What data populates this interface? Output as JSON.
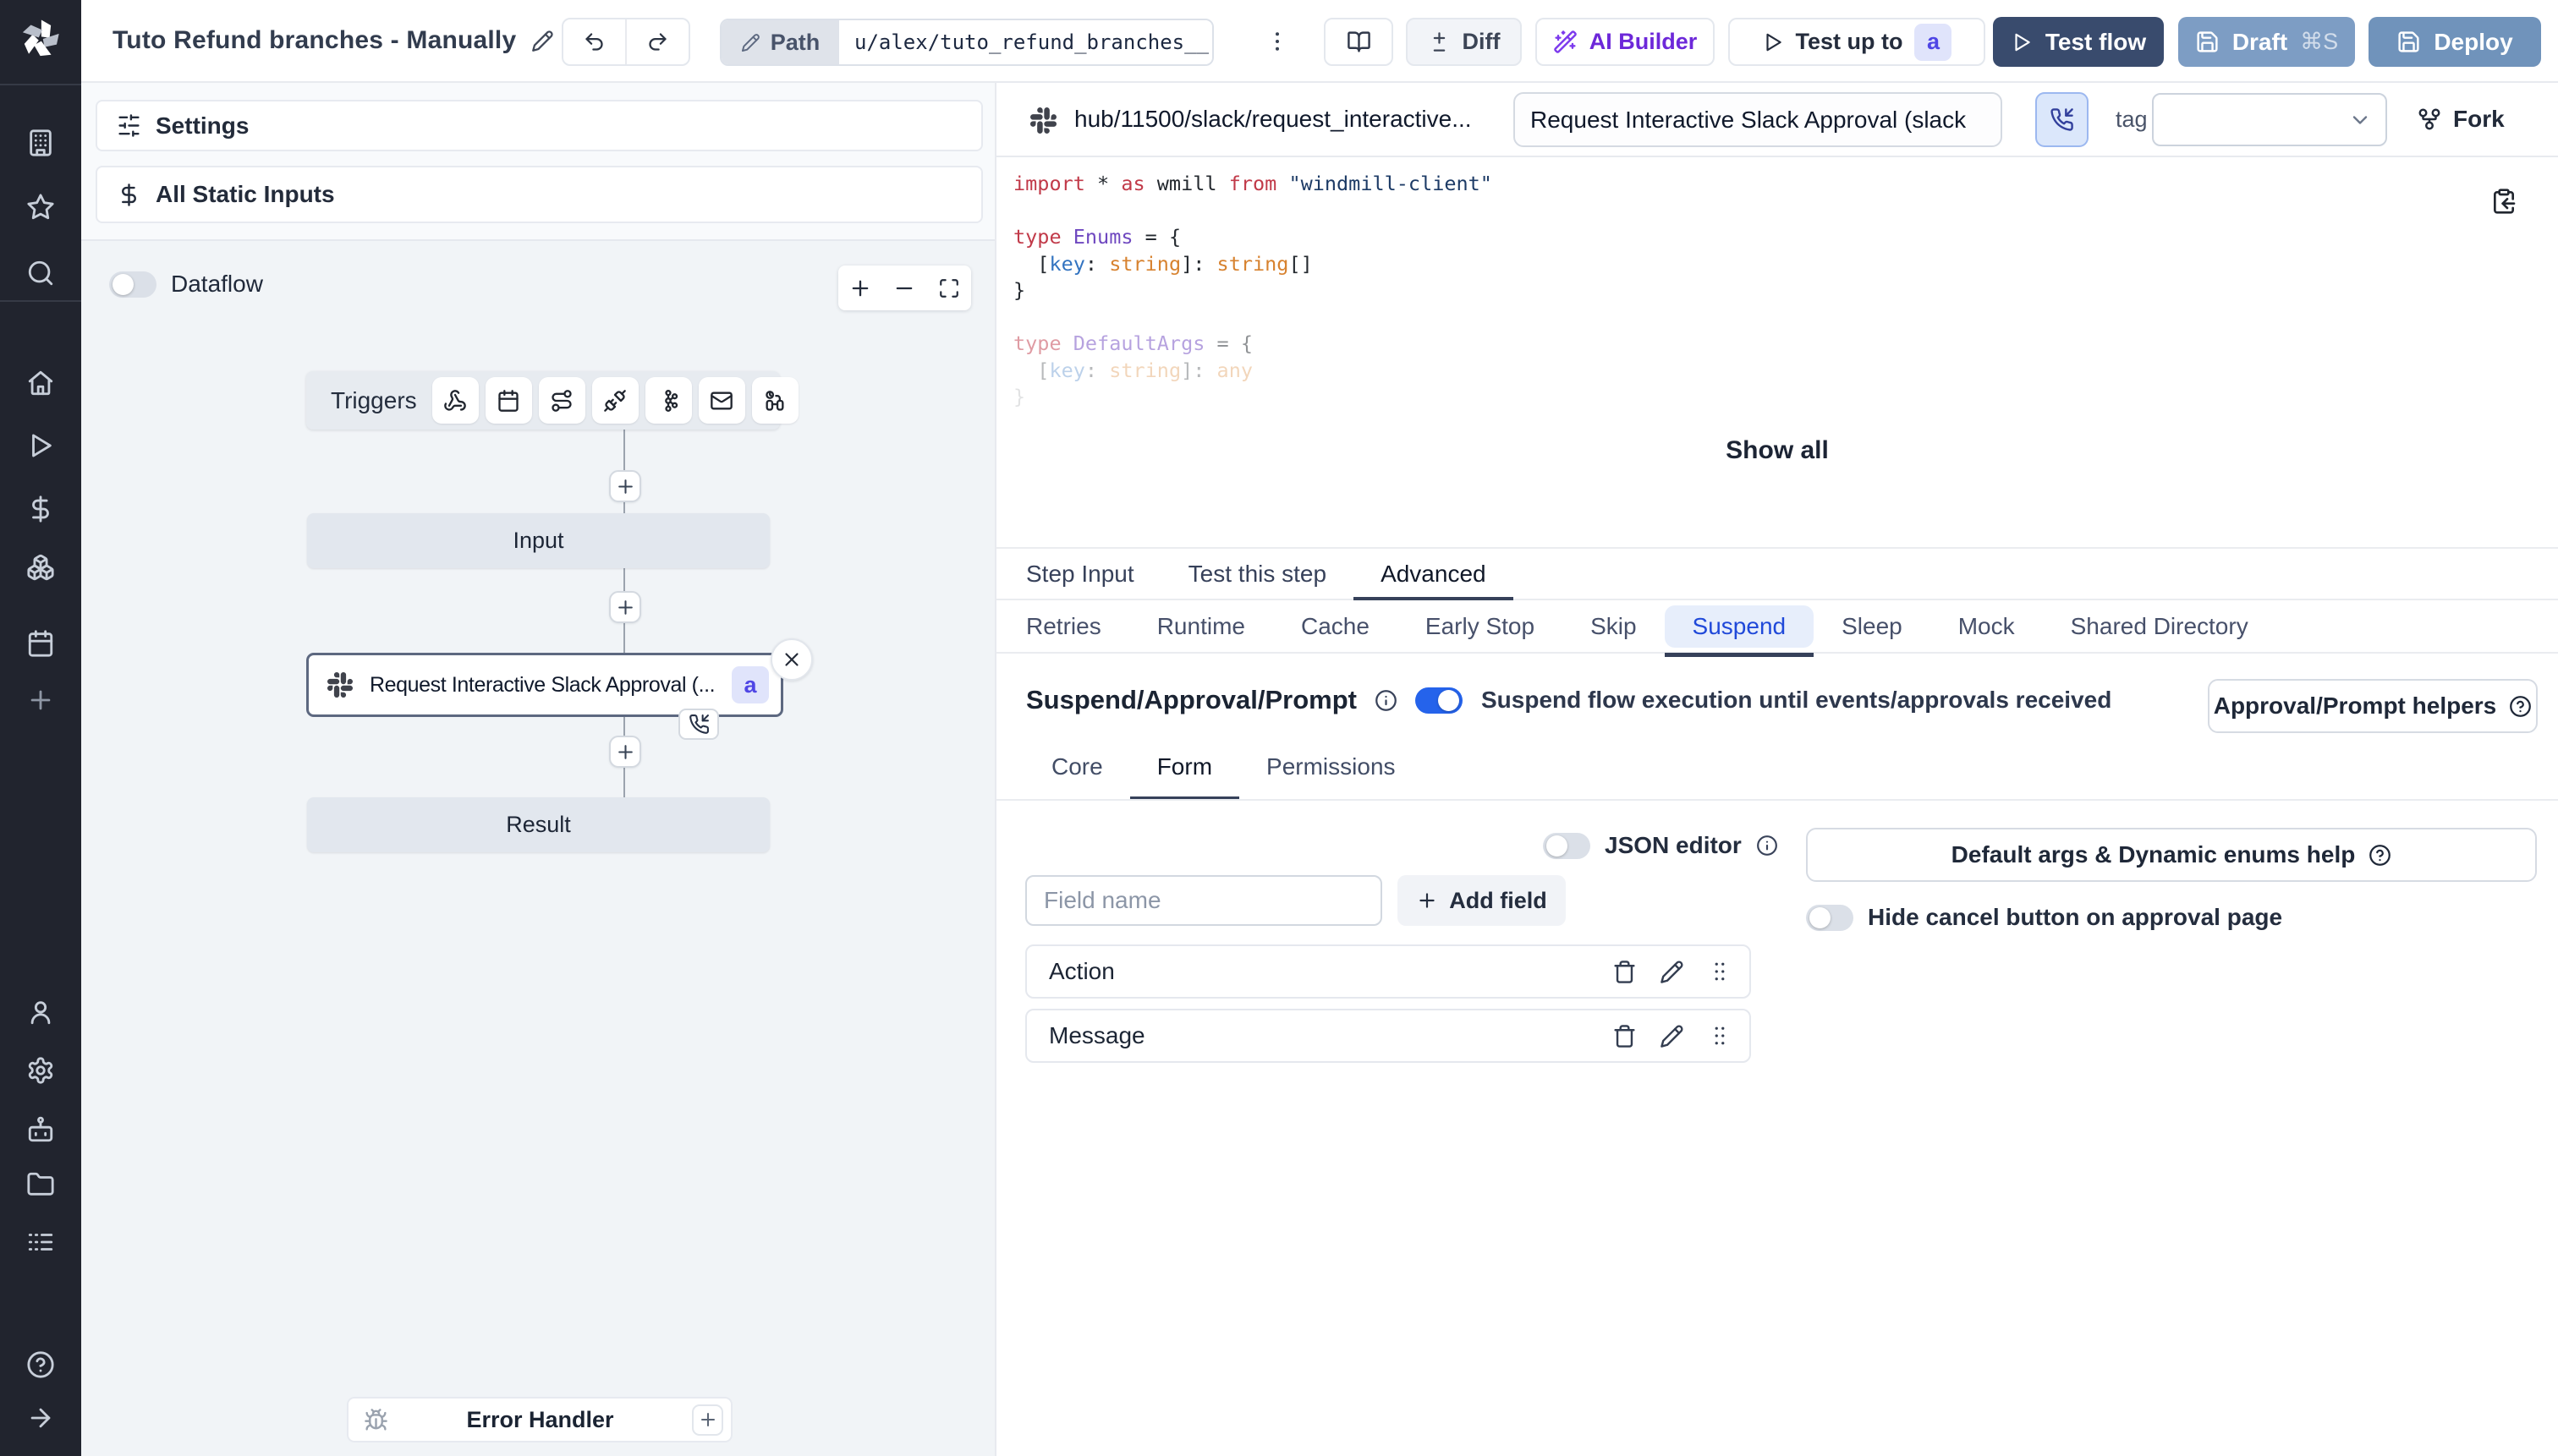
{
  "accent_colors": {
    "toggle_on": "#2563eb",
    "test_flow_bg": "#394b6d",
    "draft_bg": "#7d9dc4",
    "deploy_bg": "#7093bb",
    "ai_builder_text": "#6d28d9",
    "suspend_tab_text": "#2049d9",
    "suspend_tab_bg": "#e7eefb",
    "badge_bg": "#e0e4fb",
    "badge_text": "#4f46e5",
    "sidebar_bg": "#21242e"
  },
  "sidebar": {
    "logo_icon": "windmill-logo",
    "items": [
      {
        "name": "workspace",
        "icon": "building-icon",
        "group": 1
      },
      {
        "name": "favorites",
        "icon": "star-icon",
        "group": 1
      },
      {
        "name": "search",
        "icon": "search-icon",
        "group": 1
      },
      {
        "name": "home",
        "icon": "home-icon",
        "group": 2
      },
      {
        "name": "runs",
        "icon": "play-icon",
        "group": 2
      },
      {
        "name": "variables",
        "icon": "dollar-icon",
        "group": 2
      },
      {
        "name": "resources",
        "icon": "boxes-icon",
        "group": 2
      },
      {
        "name": "schedules",
        "icon": "calendar-icon",
        "group": 2
      },
      {
        "name": "more",
        "icon": "plus-icon",
        "group": 2
      },
      {
        "name": "account",
        "icon": "user-icon",
        "group": 3
      },
      {
        "name": "settings",
        "icon": "gear-icon",
        "group": 3
      },
      {
        "name": "workers",
        "icon": "robot-icon",
        "group": 3
      },
      {
        "name": "folders",
        "icon": "folder-icon",
        "group": 3
      },
      {
        "name": "audit-logs",
        "icon": "logs-icon",
        "group": 3
      },
      {
        "name": "help",
        "icon": "help-icon",
        "group": 4
      },
      {
        "name": "expand",
        "icon": "arrow-right-icon",
        "group": 4
      }
    ]
  },
  "header": {
    "title": "Tuto Refund branches - Manually",
    "path_label": "Path",
    "path_value": "u/alex/tuto_refund_branches__",
    "diff_label": "Diff",
    "ai_builder_label": "AI Builder",
    "test_up_to_label": "Test up to",
    "test_up_to_badge": "a",
    "test_flow_label": "Test flow",
    "draft_label": "Draft",
    "draft_shortcut": "⌘S",
    "deploy_label": "Deploy"
  },
  "left_panel": {
    "settings_label": "Settings",
    "static_inputs_label": "All Static Inputs",
    "dataflow_label": "Dataflow",
    "dataflow_on": false,
    "graph": {
      "triggers_label": "Triggers",
      "trigger_icons": [
        "webhook-icon",
        "calendar-icon",
        "route-icon",
        "plug-icon",
        "kafka-icon",
        "mail-icon",
        "poll-icon"
      ],
      "input_label": "Input",
      "step": {
        "name": "Request Interactive Slack Approval (...",
        "badge": "a",
        "icon": "slack-icon"
      },
      "result_label": "Result",
      "error_handler_label": "Error Handler"
    }
  },
  "right_panel": {
    "script_path": "hub/11500/slack/request_interactive...",
    "step_name_value": "Request Interactive Slack Approval (slack",
    "tag_label": "tag",
    "tag_value": "",
    "fork_label": "Fork",
    "code": {
      "show_all_label": "Show all",
      "lines": [
        {
          "opacity": 1,
          "tokens": [
            [
              "import",
              "kw"
            ],
            [
              " * ",
              "pl"
            ],
            [
              "as",
              "kw"
            ],
            [
              " wmill ",
              "pl"
            ],
            [
              "from",
              "kw"
            ],
            [
              " ",
              "pl"
            ],
            [
              "\"windmill-client\"",
              "str"
            ]
          ]
        },
        {
          "opacity": 1,
          "tokens": []
        },
        {
          "opacity": 1,
          "tokens": [
            [
              "type",
              "kw"
            ],
            [
              " ",
              "pl"
            ],
            [
              "Enums",
              "tp"
            ],
            [
              " = {",
              "pl"
            ]
          ]
        },
        {
          "opacity": 1,
          "tokens": [
            [
              "  [",
              "pl"
            ],
            [
              "key",
              "id"
            ],
            [
              ": ",
              "pl"
            ],
            [
              "string",
              "ty"
            ],
            [
              "]: ",
              "pl"
            ],
            [
              "string",
              "ty"
            ],
            [
              "[]",
              "pl"
            ]
          ]
        },
        {
          "opacity": 1,
          "tokens": [
            [
              "}",
              "pl"
            ]
          ]
        },
        {
          "opacity": 1,
          "tokens": []
        },
        {
          "opacity": 0.5,
          "tokens": [
            [
              "type",
              "kw"
            ],
            [
              " ",
              "pl"
            ],
            [
              "DefaultArgs",
              "tp"
            ],
            [
              " = {",
              "pl"
            ]
          ]
        },
        {
          "opacity": 0.32,
          "tokens": [
            [
              "  [",
              "pl"
            ],
            [
              "key",
              "id"
            ],
            [
              ": ",
              "pl"
            ],
            [
              "string",
              "ty"
            ],
            [
              "]: ",
              "pl"
            ],
            [
              "any",
              "ty"
            ]
          ]
        },
        {
          "opacity": 0.13,
          "tokens": [
            [
              "}",
              "pl"
            ]
          ]
        }
      ]
    },
    "tabs": [
      "Step Input",
      "Test this step",
      "Advanced"
    ],
    "active_tab": "Advanced",
    "subtabs": [
      "Retries",
      "Runtime",
      "Cache",
      "Early Stop",
      "Skip",
      "Suspend",
      "Sleep",
      "Mock",
      "Shared Directory"
    ],
    "active_subtab": "Suspend",
    "suspend": {
      "heading": "Suspend/Approval/Prompt",
      "toggle_on": true,
      "toggle_text": "Suspend flow execution until events/approvals received",
      "helpers_button_label": "Approval/Prompt helpers",
      "form_tabs": [
        "Core",
        "Form",
        "Permissions"
      ],
      "active_form_tab": "Form",
      "json_editor_label": "JSON editor",
      "json_editor_on": false,
      "default_args_button_label": "Default args & Dynamic enums help",
      "field_name_placeholder": "Field name",
      "add_field_label": "Add field",
      "hide_cancel_label": "Hide cancel button on approval page",
      "hide_cancel_on": false,
      "fields": [
        "Action",
        "Message"
      ]
    }
  }
}
